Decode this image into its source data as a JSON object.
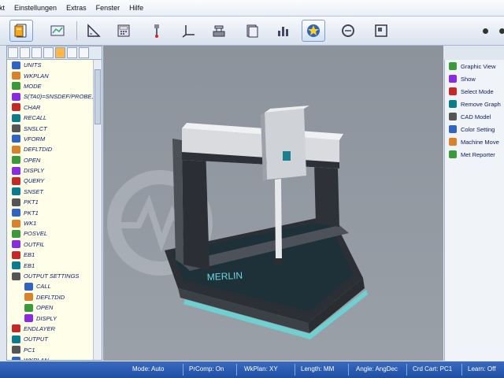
{
  "menu": {
    "items": [
      "ekt",
      "Einstellungen",
      "Extras",
      "Fenster",
      "Hilfe"
    ]
  },
  "left_panel": {
    "commands": [
      {
        "label": "UNITS",
        "icon": "units-icon",
        "sub": false
      },
      {
        "label": "WKPLAN",
        "icon": "workplane-icon",
        "sub": false
      },
      {
        "label": "MODE",
        "icon": "mode-icon",
        "sub": false
      },
      {
        "label": "S(TA0)=SNSDEF/PROBE,",
        "icon": "sensor-def-icon",
        "sub": false
      },
      {
        "label": "CHAR",
        "icon": "char-icon",
        "sub": false
      },
      {
        "label": "RECALL",
        "icon": "recall-icon",
        "sub": false
      },
      {
        "label": "SNSLCT",
        "icon": "sensor-select-icon",
        "sub": false
      },
      {
        "label": "VFORM",
        "icon": "vform-icon",
        "sub": false
      },
      {
        "label": "DEFLTDID",
        "icon": "default-did-icon",
        "sub": false
      },
      {
        "label": "OPEN",
        "icon": "open-icon",
        "sub": false
      },
      {
        "label": "DISPLY",
        "icon": "display-icon",
        "sub": false
      },
      {
        "label": "QUERY",
        "icon": "query-icon",
        "sub": false
      },
      {
        "label": "SNSET",
        "icon": "sensor-set-icon",
        "sub": false
      },
      {
        "label": "PKT1",
        "icon": "point-icon",
        "sub": false
      },
      {
        "label": "PKT1",
        "icon": "point-icon",
        "sub": false
      },
      {
        "label": "WK1",
        "icon": "workpiece-icon",
        "sub": false
      },
      {
        "label": "POSVEL",
        "icon": "position-velocity-icon",
        "sub": false
      },
      {
        "label": "OUTFIL",
        "icon": "output-file-icon",
        "sub": false
      },
      {
        "label": "EB1",
        "icon": "plane-icon",
        "sub": false
      },
      {
        "label": "EB1",
        "icon": "plane-icon",
        "sub": false
      },
      {
        "label": "OUTPUT SETTINGS",
        "icon": "output-settings-icon",
        "sub": false
      },
      {
        "label": "CALL",
        "icon": "call-icon",
        "sub": true
      },
      {
        "label": "DEFLTDID",
        "icon": "default-did-icon",
        "sub": true
      },
      {
        "label": "OPEN",
        "icon": "open-icon",
        "sub": true
      },
      {
        "label": "DISPLY",
        "icon": "display-icon",
        "sub": true
      },
      {
        "label": "ENDLAYER",
        "icon": "end-layer-icon",
        "sub": false
      },
      {
        "label": "OUTPUT",
        "icon": "output-icon",
        "sub": false
      },
      {
        "label": "PC1",
        "icon": "pc-icon",
        "sub": false
      },
      {
        "label": "WKPLAN",
        "icon": "workplane-icon",
        "sub": false
      }
    ]
  },
  "viewport": {
    "machine_label": "MERLIN"
  },
  "right_panel": {
    "items": [
      {
        "label": "Graphic View",
        "icon": "graphic-view-icon"
      },
      {
        "label": "Show",
        "icon": "show-icon"
      },
      {
        "label": "Select Mode",
        "icon": "select-mode-icon"
      },
      {
        "label": "Remove Graph",
        "icon": "remove-graphic-icon"
      },
      {
        "label": "CAD Model",
        "icon": "cad-model-icon"
      },
      {
        "label": "Color Setting",
        "icon": "color-setting-icon"
      },
      {
        "label": "Machine Move",
        "icon": "machine-move-icon"
      },
      {
        "label": "Met Reporter",
        "icon": "met-reporter-icon"
      }
    ]
  },
  "statusbar": {
    "mode": "Mode: Auto",
    "prcomp": "PrComp: On",
    "wkplan": "WkPlan: XY",
    "length": "Length: MM",
    "angle": "Angle: AngDec",
    "crd_cart": "Crd Cart: PC1",
    "learn": "Learn: Off"
  },
  "colors": {
    "accent": "#2a5bb5",
    "panel_bg": "#fefee9",
    "viewport_bg": "#959ba3"
  }
}
